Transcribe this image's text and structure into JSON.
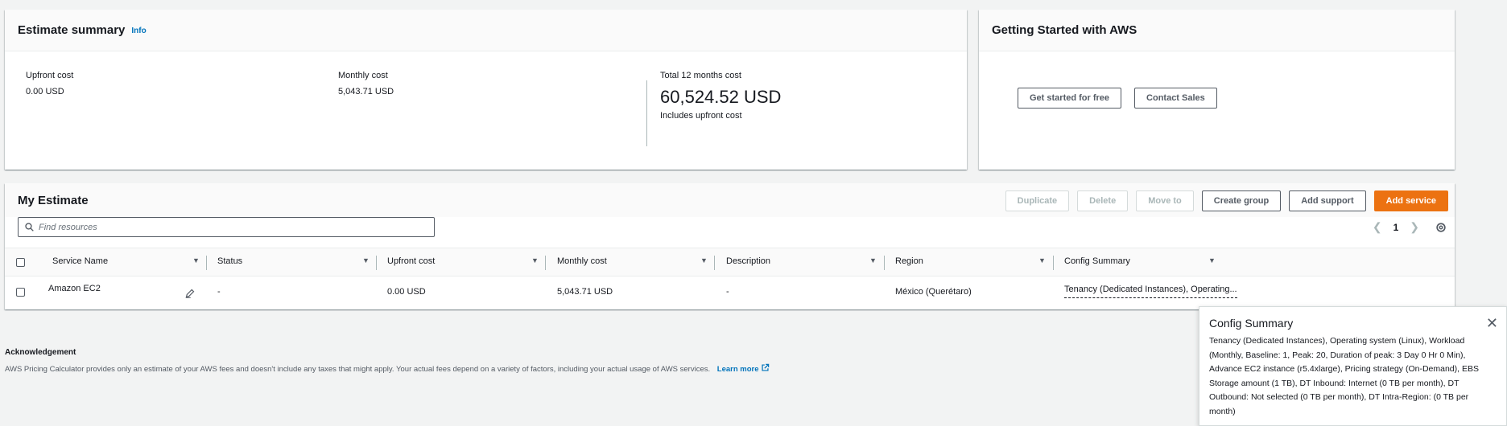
{
  "summary": {
    "title": "Estimate summary",
    "info": "Info",
    "upfront_label": "Upfront cost",
    "upfront_value": "0.00 USD",
    "monthly_label": "Monthly cost",
    "monthly_value": "5,043.71 USD",
    "total_label": "Total 12 months cost",
    "total_value": "60,524.52 USD",
    "total_sub": "Includes upfront cost"
  },
  "getting_started": {
    "title": "Getting Started with AWS",
    "free_button": "Get started for free",
    "sales_button": "Contact Sales"
  },
  "estimate": {
    "title": "My Estimate",
    "buttons": {
      "duplicate": "Duplicate",
      "delete": "Delete",
      "move_to": "Move to",
      "create_group": "Create group",
      "add_support": "Add support",
      "add_service": "Add service"
    },
    "search_placeholder": "Find resources",
    "page": "1",
    "columns": [
      "Service Name",
      "Status",
      "Upfront cost",
      "Monthly cost",
      "Description",
      "Region",
      "Config Summary"
    ],
    "row": {
      "service": "Amazon EC2",
      "status": "-",
      "upfront": "0.00 USD",
      "monthly": "5,043.71 USD",
      "description": "-",
      "region": "México (Querétaro)",
      "config": "Tenancy (Dedicated Instances), Operating..."
    }
  },
  "popover": {
    "title": "Config Summary",
    "body": "Tenancy (Dedicated Instances), Operating system (Linux), Workload (Monthly, Baseline: 1, Peak: 20, Duration of peak: 3 Day 0 Hr 0 Min), Advance EC2 instance (r5.4xlarge), Pricing strategy (On-Demand), EBS Storage amount (1 TB), DT Inbound: Internet (0 TB per month), DT Outbound: Not selected (0 TB per month), DT Intra-Region: (0 TB per month)"
  },
  "acknowledgement": {
    "title": "Acknowledgement",
    "text": "AWS Pricing Calculator provides only an estimate of your AWS fees and doesn't include any taxes that might apply. Your actual fees depend on a variety of factors, including your actual usage of AWS services.",
    "learn_more": "Learn more"
  },
  "icons": {
    "edit": "pencil-icon",
    "settings": "gear-icon",
    "search": "search-icon",
    "external": "external-link-icon",
    "close": "close-icon"
  },
  "colors": {
    "accent": "#ec7211",
    "link": "#0073bb"
  }
}
